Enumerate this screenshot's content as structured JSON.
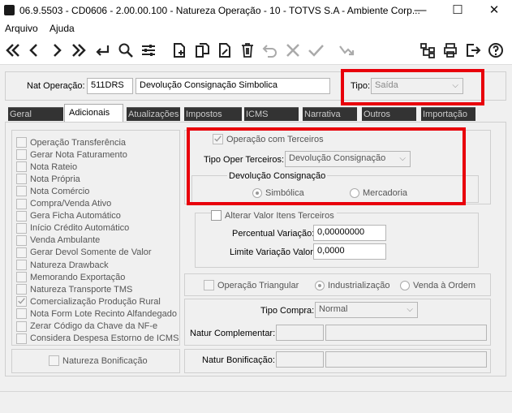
{
  "window": {
    "title": "06.9.5503 - CD0606 - 2.00.00.100 - Natureza Operação - 10 - TOTVS S.A - Ambiente Corp...",
    "minimize": "—",
    "maximize": "☐",
    "close": "✕"
  },
  "menu": [
    "Arquivo",
    "Ajuda"
  ],
  "toolbar": [
    "first-icon",
    "prev-icon",
    "next-icon",
    "last-icon",
    "goto-icon",
    "search-icon",
    "filter-icon",
    "new-icon",
    "copy-icon",
    "edit-icon",
    "delete-icon",
    "undo-icon",
    "cancel-icon",
    "confirm-icon",
    "related-icon",
    "tree-icon",
    "print-icon",
    "exit-icon",
    "help-icon"
  ],
  "header": {
    "nat_label": "Nat Operação:",
    "code": "511DRS",
    "description": "Devolução Consignação Simbolica",
    "tipo_label": "Tipo:",
    "tipo_value": "Saída"
  },
  "tabs": [
    "Geral",
    "Adicionais",
    "Atualizações",
    "Impostos",
    "ICMS",
    "Narrativa",
    "Outros",
    "Importação"
  ],
  "left_checks": [
    "Operação Transferência",
    "Gerar Nota Faturamento",
    "Nota Rateio",
    "Nota Própria",
    "Nota Comércio",
    "Compra/Venda Ativo",
    "Gera Ficha Automático",
    "Início Crédito Automático",
    "Venda Ambulante",
    "Gerar Devol Somente de Valor",
    "Natureza Drawback",
    "Memorando Exportação",
    "Natureza Transporte TMS",
    "Comercialização Produção Rural",
    "Nota Form Lote Recinto Alfandegado",
    "Zerar Código da Chave da NF-e",
    "Considera Despesa Estorno de ICMS"
  ],
  "terceiros": {
    "check_label": "Operação com Terceiros",
    "tipo_oper_label": "Tipo Oper Terceiros:",
    "tipo_oper_value": "Devolução Consignação",
    "group_title": "Devolução Consignação",
    "radio_simbolica": "Simbólica",
    "radio_mercadoria": "Mercadoria"
  },
  "valor_itens": {
    "check_label": "Alterar Valor Itens Terceiros",
    "percentual_label": "Percentual Variação:",
    "percentual_value": "0,00000000",
    "limite_label": "Limite Variação Valor:",
    "limite_value": "0,0000"
  },
  "triangular": {
    "check_label": "Operação Triangular",
    "radio_industrializacao": "Industrialização",
    "radio_venda": "Venda à Ordem"
  },
  "compra": {
    "tipo_compra_label": "Tipo Compra:",
    "tipo_compra_value": "Normal",
    "natur_complementar_label": "Natur Complementar:"
  },
  "bonificacao": {
    "check_label": "Natureza Bonificação",
    "natur_bonificacao_label": "Natur Bonificação:"
  },
  "colors": {
    "highlight": "#e8000b",
    "tab_inactive": "#333333"
  }
}
